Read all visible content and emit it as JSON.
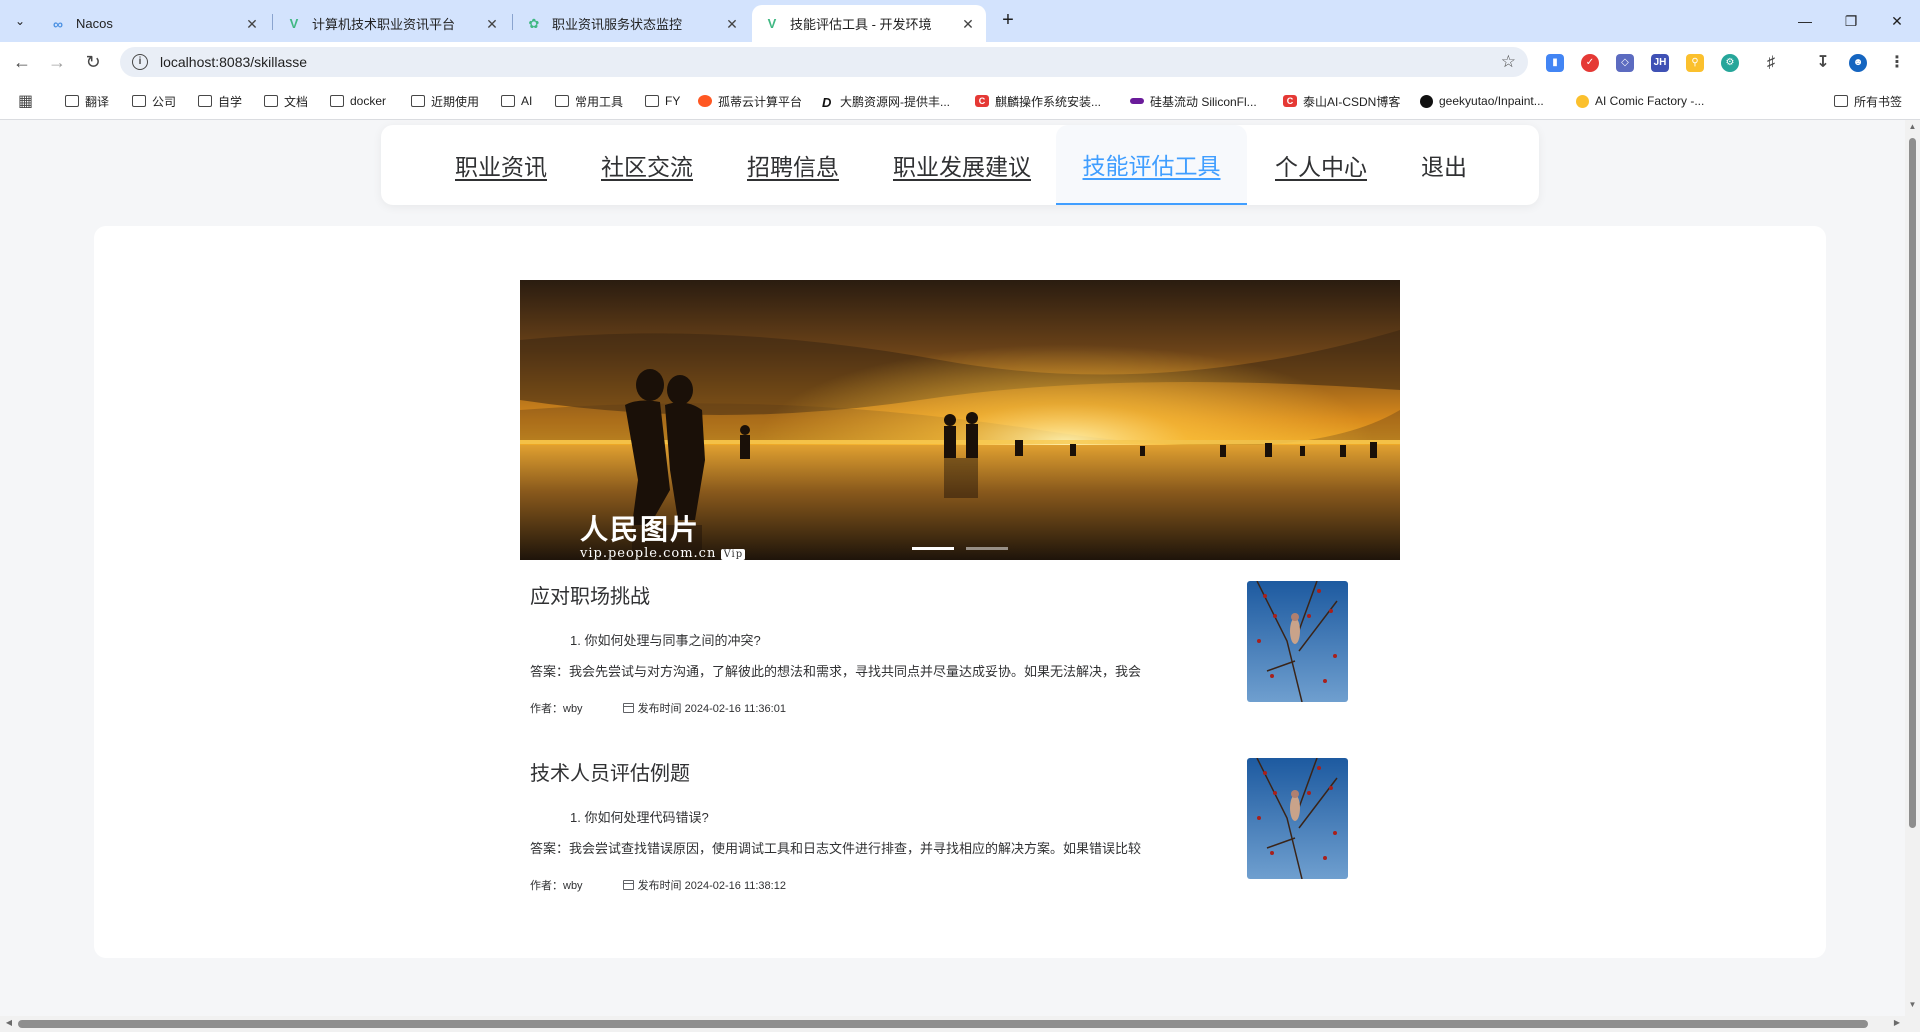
{
  "browser": {
    "tabs": [
      {
        "title": "Nacos",
        "active": false
      },
      {
        "title": "计算机技术职业资讯平台",
        "active": false
      },
      {
        "title": "职业资讯服务状态监控",
        "active": false
      },
      {
        "title": "技能评估工具 - 开发环境",
        "active": true
      }
    ],
    "url": "localhost:8083/skillasse",
    "bookmarks": [
      "翻译",
      "公司",
      "自学",
      "文档",
      "docker",
      "近期使用",
      "AI",
      "常用工具",
      "FY",
      "孤蒂云计算平台",
      "大鹏资源网-提供丰...",
      "麒麟操作系统安装...",
      "硅基流动 SiliconFl...",
      "泰山AI-CSDN博客",
      "geekyutao/Inpaint...",
      "AI Comic Factory -..."
    ],
    "all_bookmarks": "所有书签"
  },
  "nav": {
    "items": [
      "职业资讯",
      "社区交流",
      "招聘信息",
      "职业发展建议",
      "技能评估工具",
      "个人中心",
      "退出"
    ],
    "active_index": 4
  },
  "banner": {
    "watermark_main": "人民图片",
    "watermark_url": "vip.people.com.cn",
    "watermark_badge": "Vip",
    "slides": 2,
    "active_slide": 0
  },
  "articles": [
    {
      "title": "应对职场挑战",
      "question": "1. 你如何处理与同事之间的冲突?",
      "answer": "答案：我会先尝试与对方沟通，了解彼此的想法和需求，寻找共同点并尽量达成妥协。如果无法解决，我会",
      "author": "作者：wby",
      "published": "发布时间 2024-02-16 11:36:01"
    },
    {
      "title": "技术人员评估例题",
      "question": "1. 你如何处理代码错误?",
      "answer": "答案：我会尝试查找错误原因，使用调试工具和日志文件进行排查，并寻找相应的解决方案。如果错误比较",
      "author": "作者：wby",
      "published": "发布时间 2024-02-16 11:38:12"
    }
  ],
  "colors": {
    "accent": "#409eff",
    "page_bg": "#f5f6f8",
    "tabstrip": "#d3e3fd"
  }
}
